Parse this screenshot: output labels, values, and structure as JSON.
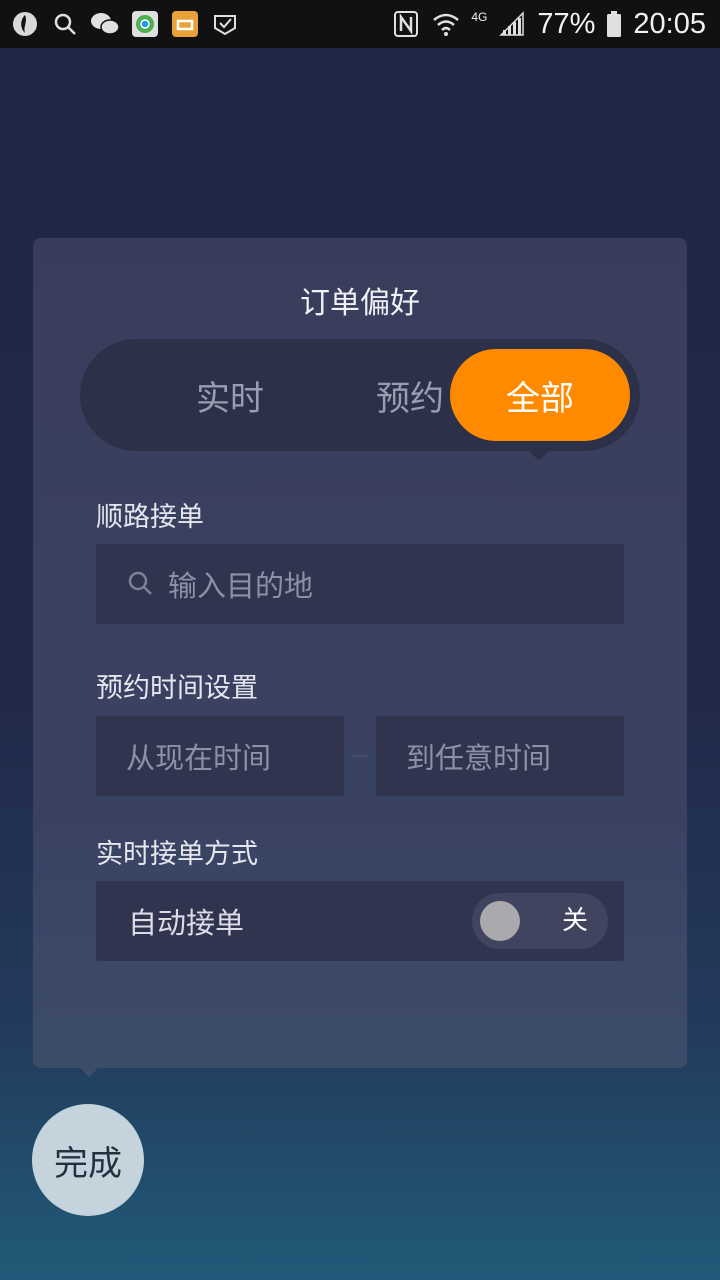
{
  "status_bar": {
    "icons": [
      "app-icon",
      "search-icon",
      "wechat-icon",
      "chrome-icon",
      "didi-icon",
      "check-icon",
      "nfc-icon",
      "wifi-icon",
      "signal-icon",
      "battery-icon"
    ],
    "network": "4G",
    "battery": "77%",
    "time": "20:05"
  },
  "card": {
    "title": "订单偏好",
    "tabs": {
      "realtime": "实时",
      "reserve": "预约",
      "all": "全部",
      "selected": "全部"
    },
    "route_section": {
      "label": "顺路接单",
      "placeholder": "输入目的地"
    },
    "reserve_time_section": {
      "label": "预约时间设置",
      "from": "从现在时间",
      "to": "到任意时间"
    },
    "realtime_section": {
      "label": "实时接单方式",
      "auto_label": "自动接单",
      "toggle_state": "关"
    }
  },
  "done_label": "完成",
  "colors": {
    "accent": "#ff8a00",
    "card": "#393d5c",
    "field": "#30344f"
  }
}
